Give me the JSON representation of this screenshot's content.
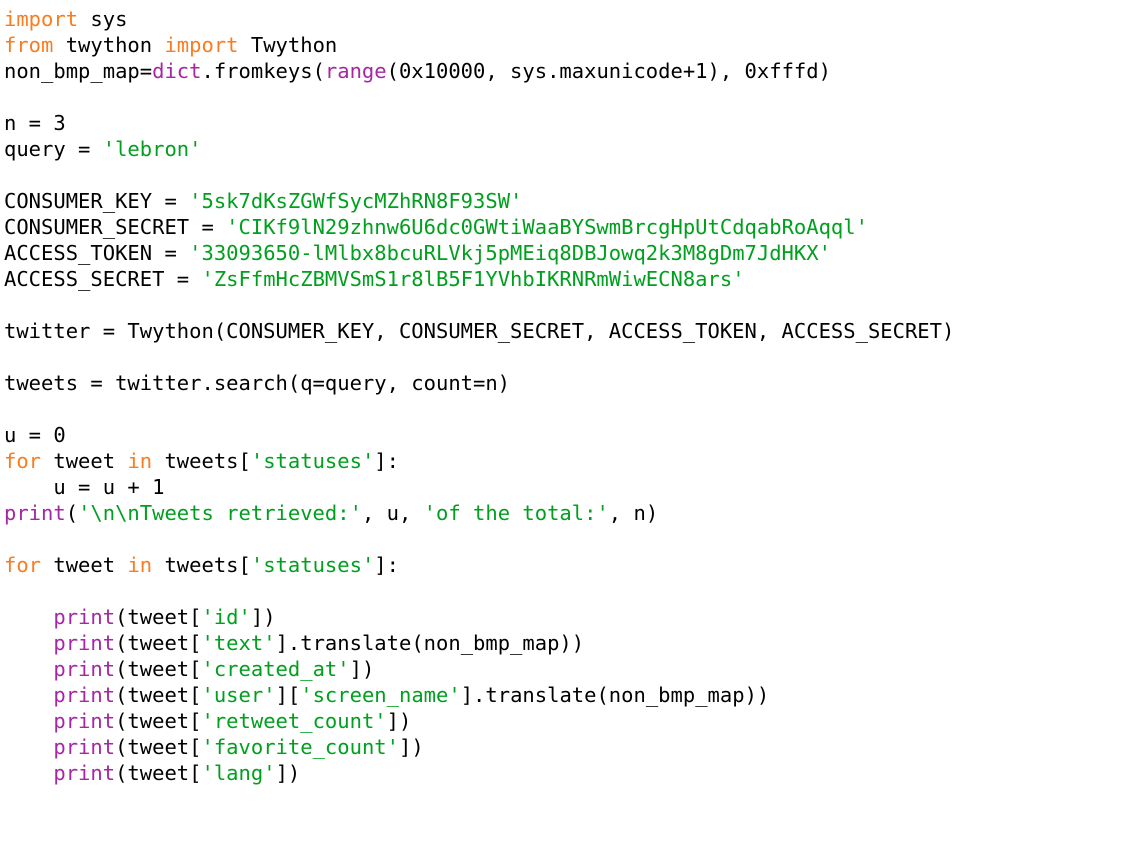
{
  "editor": {
    "language": "Python",
    "background_color": "#ffffff",
    "colors": {
      "keyword": "#f97d20",
      "builtin": "#a626a4",
      "string": "#00a01e",
      "plain": "#000000"
    }
  },
  "code": {
    "lines": [
      {
        "id": "l1",
        "indent": 0,
        "tokens": [
          {
            "t": "import",
            "c": "kw"
          },
          {
            "t": " sys",
            "c": "plain"
          }
        ]
      },
      {
        "id": "l2",
        "indent": 0,
        "tokens": [
          {
            "t": "from",
            "c": "kw"
          },
          {
            "t": " twython ",
            "c": "plain"
          },
          {
            "t": "import",
            "c": "kw"
          },
          {
            "t": " Twython",
            "c": "plain"
          }
        ]
      },
      {
        "id": "l3",
        "indent": 0,
        "tokens": [
          {
            "t": "non_bmp_map=",
            "c": "plain"
          },
          {
            "t": "dict",
            "c": "builtin"
          },
          {
            "t": ".fromkeys(",
            "c": "plain"
          },
          {
            "t": "range",
            "c": "builtin"
          },
          {
            "t": "(0x10000, sys.maxunicode+1), 0xfffd)",
            "c": "plain"
          }
        ]
      },
      {
        "id": "l4",
        "indent": 0,
        "tokens": []
      },
      {
        "id": "l5",
        "indent": 0,
        "tokens": [
          {
            "t": "n = 3",
            "c": "plain"
          }
        ]
      },
      {
        "id": "l6",
        "indent": 0,
        "tokens": [
          {
            "t": "query = ",
            "c": "plain"
          },
          {
            "t": "'lebron'",
            "c": "str"
          }
        ]
      },
      {
        "id": "l7",
        "indent": 0,
        "tokens": []
      },
      {
        "id": "l8",
        "indent": 0,
        "tokens": [
          {
            "t": "CONSUMER_KEY = ",
            "c": "plain"
          },
          {
            "t": "'5sk7dKsZGWfSycMZhRN8F93SW'",
            "c": "str"
          }
        ]
      },
      {
        "id": "l9",
        "indent": 0,
        "tokens": [
          {
            "t": "CONSUMER_SECRET = ",
            "c": "plain"
          },
          {
            "t": "'CIKf9lN29zhnw6U6dc0GWtiWaaBYSwmBrcgHpUtCdqabRoAqql'",
            "c": "str"
          }
        ]
      },
      {
        "id": "l10",
        "indent": 0,
        "tokens": [
          {
            "t": "ACCESS_TOKEN = ",
            "c": "plain"
          },
          {
            "t": "'33093650-lMlbx8bcuRLVkj5pMEiq8DBJowq2k3M8gDm7JdHKX'",
            "c": "str"
          }
        ]
      },
      {
        "id": "l11",
        "indent": 0,
        "tokens": [
          {
            "t": "ACCESS_SECRET = ",
            "c": "plain"
          },
          {
            "t": "'ZsFfmHcZBMVSmS1r8lB5F1YVhbIKRNRmWiwECN8ars'",
            "c": "str"
          }
        ]
      },
      {
        "id": "l12",
        "indent": 0,
        "tokens": []
      },
      {
        "id": "l13",
        "indent": 0,
        "tokens": [
          {
            "t": "twitter = Twython(CONSUMER_KEY, CONSUMER_SECRET, ACCESS_TOKEN, ACCESS_SECRET)",
            "c": "plain"
          }
        ]
      },
      {
        "id": "l14",
        "indent": 0,
        "tokens": []
      },
      {
        "id": "l15",
        "indent": 0,
        "tokens": [
          {
            "t": "tweets = twitter.search(q=query, count=n)",
            "c": "plain"
          }
        ]
      },
      {
        "id": "l16",
        "indent": 0,
        "tokens": []
      },
      {
        "id": "l17",
        "indent": 0,
        "tokens": [
          {
            "t": "u = 0",
            "c": "plain"
          }
        ]
      },
      {
        "id": "l18",
        "indent": 0,
        "tokens": [
          {
            "t": "for",
            "c": "kw"
          },
          {
            "t": " tweet ",
            "c": "plain"
          },
          {
            "t": "in",
            "c": "kw"
          },
          {
            "t": " tweets[",
            "c": "plain"
          },
          {
            "t": "'statuses'",
            "c": "str"
          },
          {
            "t": "]:",
            "c": "plain"
          }
        ]
      },
      {
        "id": "l19",
        "indent": 0,
        "tokens": [
          {
            "t": "    u = u + 1",
            "c": "plain"
          }
        ]
      },
      {
        "id": "l20",
        "indent": 0,
        "tokens": [
          {
            "t": "print",
            "c": "builtin"
          },
          {
            "t": "(",
            "c": "plain"
          },
          {
            "t": "'\\n\\nTweets retrieved:'",
            "c": "str"
          },
          {
            "t": ", u, ",
            "c": "plain"
          },
          {
            "t": "'of the total:'",
            "c": "str"
          },
          {
            "t": ", n)",
            "c": "plain"
          }
        ]
      },
      {
        "id": "l21",
        "indent": 0,
        "tokens": []
      },
      {
        "id": "l22",
        "indent": 0,
        "tokens": [
          {
            "t": "for",
            "c": "kw"
          },
          {
            "t": " tweet ",
            "c": "plain"
          },
          {
            "t": "in",
            "c": "kw"
          },
          {
            "t": " tweets[",
            "c": "plain"
          },
          {
            "t": "'statuses'",
            "c": "str"
          },
          {
            "t": "]:",
            "c": "plain"
          }
        ]
      },
      {
        "id": "l23",
        "indent": 0,
        "tokens": []
      },
      {
        "id": "l24",
        "indent": 0,
        "tokens": [
          {
            "t": "    ",
            "c": "plain"
          },
          {
            "t": "print",
            "c": "builtin"
          },
          {
            "t": "(tweet[",
            "c": "plain"
          },
          {
            "t": "'id'",
            "c": "str"
          },
          {
            "t": "])",
            "c": "plain"
          }
        ]
      },
      {
        "id": "l25",
        "indent": 0,
        "tokens": [
          {
            "t": "    ",
            "c": "plain"
          },
          {
            "t": "print",
            "c": "builtin"
          },
          {
            "t": "(tweet[",
            "c": "plain"
          },
          {
            "t": "'text'",
            "c": "str"
          },
          {
            "t": "].translate(non_bmp_map))",
            "c": "plain"
          }
        ]
      },
      {
        "id": "l26",
        "indent": 0,
        "tokens": [
          {
            "t": "    ",
            "c": "plain"
          },
          {
            "t": "print",
            "c": "builtin"
          },
          {
            "t": "(tweet[",
            "c": "plain"
          },
          {
            "t": "'created_at'",
            "c": "str"
          },
          {
            "t": "])",
            "c": "plain"
          }
        ]
      },
      {
        "id": "l27",
        "indent": 0,
        "tokens": [
          {
            "t": "    ",
            "c": "plain"
          },
          {
            "t": "print",
            "c": "builtin"
          },
          {
            "t": "(tweet[",
            "c": "plain"
          },
          {
            "t": "'user'",
            "c": "str"
          },
          {
            "t": "][",
            "c": "plain"
          },
          {
            "t": "'screen_name'",
            "c": "str"
          },
          {
            "t": "].translate(non_bmp_map))",
            "c": "plain"
          }
        ]
      },
      {
        "id": "l28",
        "indent": 0,
        "tokens": [
          {
            "t": "    ",
            "c": "plain"
          },
          {
            "t": "print",
            "c": "builtin"
          },
          {
            "t": "(tweet[",
            "c": "plain"
          },
          {
            "t": "'retweet_count'",
            "c": "str"
          },
          {
            "t": "])",
            "c": "plain"
          }
        ]
      },
      {
        "id": "l29",
        "indent": 0,
        "tokens": [
          {
            "t": "    ",
            "c": "plain"
          },
          {
            "t": "print",
            "c": "builtin"
          },
          {
            "t": "(tweet[",
            "c": "plain"
          },
          {
            "t": "'favorite_count'",
            "c": "str"
          },
          {
            "t": "])",
            "c": "plain"
          }
        ]
      },
      {
        "id": "l30",
        "indent": 0,
        "tokens": [
          {
            "t": "    ",
            "c": "plain"
          },
          {
            "t": "print",
            "c": "builtin"
          },
          {
            "t": "(tweet[",
            "c": "plain"
          },
          {
            "t": "'lang'",
            "c": "str"
          },
          {
            "t": "])",
            "c": "plain"
          }
        ]
      }
    ]
  }
}
